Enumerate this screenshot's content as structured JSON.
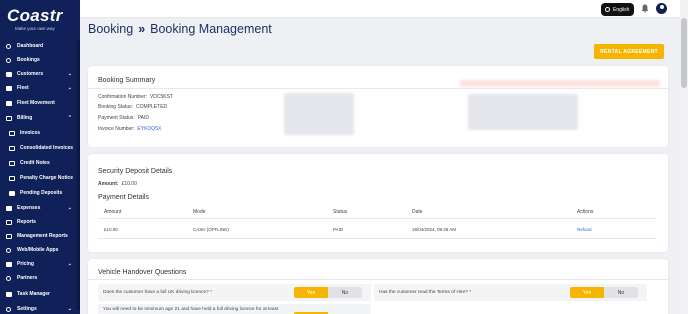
{
  "brand": {
    "logo": "Coastr",
    "tagline": "Make your own way"
  },
  "topbar": {
    "language": "English"
  },
  "sidebar": {
    "items": [
      {
        "label": "Dashboard"
      },
      {
        "label": "Bookings"
      },
      {
        "label": "Customers"
      },
      {
        "label": "Fleet"
      },
      {
        "label": "Fleet Movement"
      },
      {
        "label": "Billing"
      },
      {
        "label": "Invoices"
      },
      {
        "label": "Consolidated Invoices"
      },
      {
        "label": "Credit Notes"
      },
      {
        "label": "Penalty Charge Notice"
      },
      {
        "label": "Pending Deposits"
      },
      {
        "label": "Expenses"
      },
      {
        "label": "Reports"
      },
      {
        "label": "Management Reports"
      },
      {
        "label": "Web/Mobile Apps"
      },
      {
        "label": "Pricing"
      },
      {
        "label": "Partners"
      },
      {
        "label": "Task Manager"
      },
      {
        "label": "Settings"
      }
    ]
  },
  "breadcrumb": {
    "part1": "Booking",
    "separator": "»",
    "part2": "Booking Management"
  },
  "actions": {
    "rental_agreement": "RENTAL AGREEMENT"
  },
  "booking_summary": {
    "title": "Booking Summary",
    "confirmation_label": "Confirmation Number:",
    "confirmation_value": "VDC5KST",
    "status_label": "Booking Status:",
    "status_value": "COMPLETED",
    "payment_label": "Payment Status:",
    "payment_value": "PAID",
    "invoice_label": "Invoice Number:",
    "invoice_value": "EYKOQ5X"
  },
  "security_deposit": {
    "title": "Security Deposit Details",
    "amount_label": "Amount:",
    "amount_value": "£10.00",
    "payment_title": "Payment Details",
    "columns": [
      "Amount",
      "Mode",
      "Status",
      "Date",
      "Actions"
    ],
    "row": {
      "amount": "£10.00",
      "mode": "CASH (OFFLINE)",
      "status": "PAID",
      "date": "16/04/2024, 09:48 AM",
      "action": "Refund"
    }
  },
  "handover": {
    "title": "Vehicle Handover Questions",
    "q1": "Does the customer have a full UK driving licence? *",
    "q2": "Has the customer read the Terms of Hire? *",
    "q3": "You will need to be minimum age 21 and have held a full driving licence for at least",
    "yes": "Yes",
    "no": "No"
  },
  "colors": {
    "accent": "#f6b500",
    "sidebar": "#10215a",
    "link": "#2a6bd1"
  }
}
